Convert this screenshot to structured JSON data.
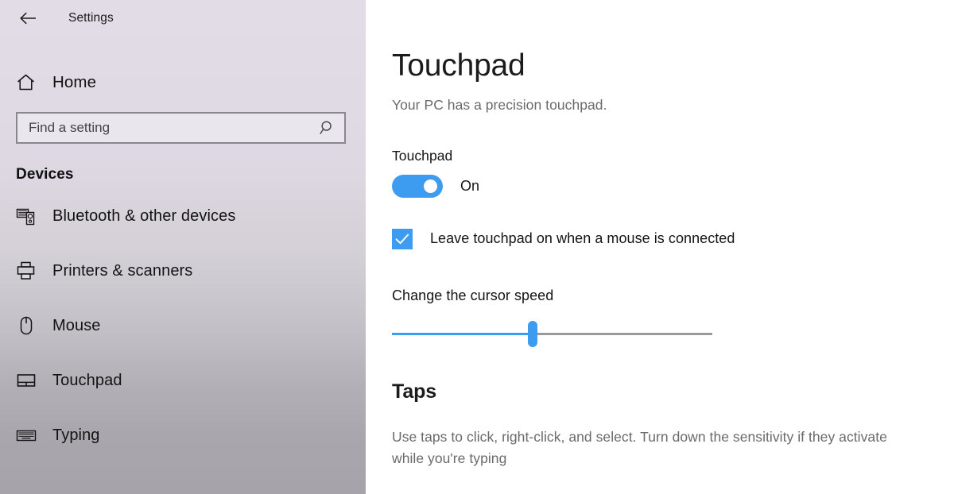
{
  "window": {
    "titlebar_title": "Settings",
    "back_icon": "back-arrow-icon"
  },
  "sidebar": {
    "home": {
      "label": "Home",
      "icon": "home-icon"
    },
    "search": {
      "placeholder": "Find a setting",
      "value": "",
      "icon": "search-icon"
    },
    "section_title": "Devices",
    "items": [
      {
        "label": "Bluetooth & other devices",
        "icon": "devices-icon",
        "selected": false
      },
      {
        "label": "Printers & scanners",
        "icon": "printer-icon",
        "selected": false
      },
      {
        "label": "Mouse",
        "icon": "mouse-icon",
        "selected": false
      },
      {
        "label": "Touchpad",
        "icon": "touchpad-icon",
        "selected": true
      },
      {
        "label": "Typing",
        "icon": "keyboard-icon",
        "selected": false
      }
    ]
  },
  "main": {
    "title": "Touchpad",
    "subtitle": "Your PC has a precision touchpad.",
    "touchpad_toggle": {
      "label": "Touchpad",
      "state_label": "On",
      "checked": true
    },
    "leave_on_checkbox": {
      "label": "Leave touchpad on when a mouse is connected",
      "checked": true
    },
    "cursor_speed": {
      "label": "Change the cursor speed",
      "value_percent": 44
    },
    "taps": {
      "title": "Taps",
      "description": "Use taps to click, right-click, and select. Turn down the sensitivity if they activate while you're typing"
    }
  },
  "colors": {
    "accent_blue": "#3d9bf0",
    "selection_blue": "#1e8ee0",
    "sidebar_top": "#e2dce6",
    "sidebar_bottom": "#a6a4aa"
  }
}
